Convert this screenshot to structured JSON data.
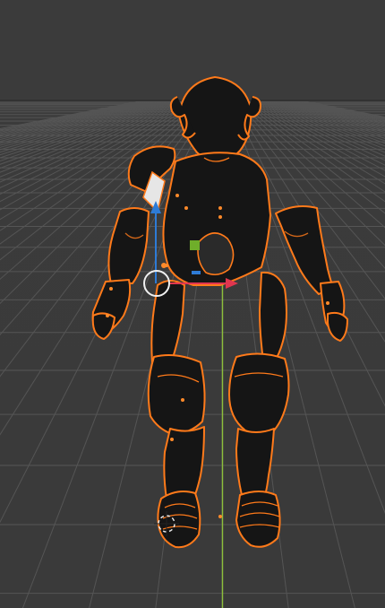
{
  "viewport": {
    "background_color": "#3b3b3b",
    "grid_color": "#555555",
    "horizon_color": "#323232",
    "selection_outline_color": "#ff7a1a",
    "object_color": "#151515",
    "axis_x_color": "#e0364f",
    "axis_y_color": "#8dbf3b",
    "axis_z_color": "#2e7bd6",
    "origin_color": "#ff8a2a"
  },
  "scene": {
    "object": "armor-figure",
    "selected": true,
    "transform_gizmo": "move-gizmo",
    "cursor": "3d-cursor"
  }
}
